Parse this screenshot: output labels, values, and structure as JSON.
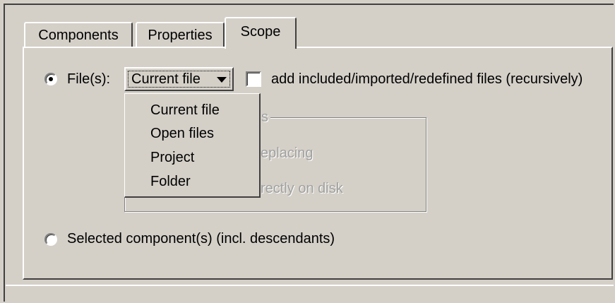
{
  "tabs": [
    {
      "label": "Components",
      "active": false
    },
    {
      "label": "Properties",
      "active": false
    },
    {
      "label": "Scope",
      "active": true
    }
  ],
  "scope": {
    "files_radio": {
      "label": "File(s):",
      "selected": true
    },
    "files_combo": {
      "value": "Current file",
      "options": [
        "Current file",
        "Open files",
        "Project",
        "Folder"
      ]
    },
    "recursive_checkbox": {
      "label": "add included/imported/redefined files (recursively)",
      "checked": false
    },
    "options_group": {
      "title_fragment": "s",
      "option1_fragment": "eplacing",
      "option2_fragment": "rectly on disk"
    },
    "component_radio": {
      "label": "Selected component(s) (incl. descendants)",
      "selected": false
    }
  },
  "colors": {
    "face": "#d4d0c8",
    "highlight": "#ffffff",
    "shadow": "#404040",
    "disabled_text": "#a0a0a0"
  }
}
